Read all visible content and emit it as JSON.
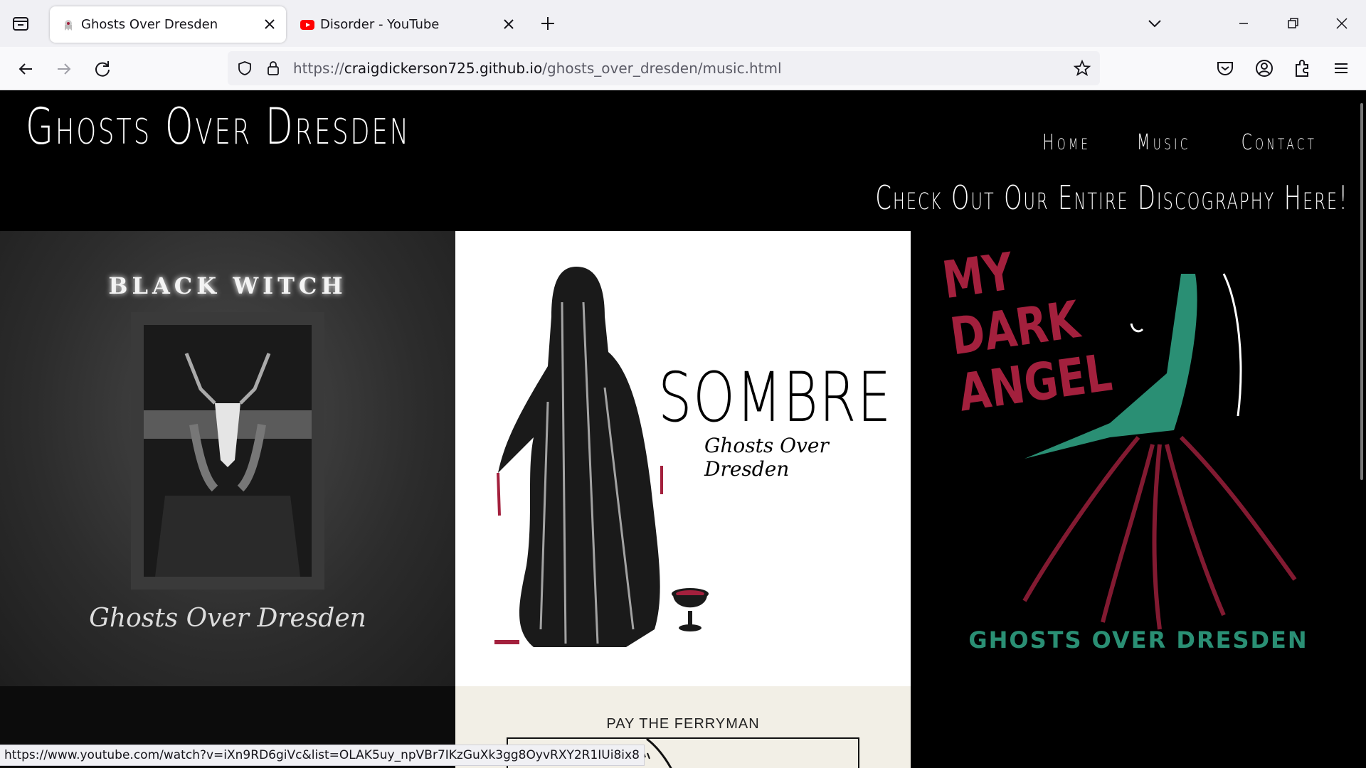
{
  "browser": {
    "tabs": [
      {
        "title": "Ghosts Over Dresden",
        "active": true,
        "favicon": "ghost-favicon"
      },
      {
        "title": "Disorder - YouTube",
        "active": false,
        "favicon": "youtube-icon"
      }
    ],
    "url": {
      "scheme": "https://",
      "host": "craigdickerson725.github.io",
      "path": "/ghosts_over_dresden/music.html"
    },
    "status_url": "https://www.youtube.com/watch?v=iXn9RD6giVc&list=OLAK5uy_npVBr7IKzGuXk3gg8OyvRXY2R1IUi8ix8"
  },
  "site": {
    "logo": "Ghosts Over Dresden",
    "nav": [
      "Home",
      "Music",
      "Contact"
    ],
    "discography_link": "Check Out Our Entire Discography Here!"
  },
  "albums": [
    {
      "title": "BLACK WITCH",
      "band": "Ghosts Over Dresden"
    },
    {
      "title": "SOMBRE",
      "band": "Ghosts Over Dresden"
    },
    {
      "title": "MY\nDARK\nANGEL",
      "band": "GHOSTS OVER DRESDEN"
    },
    {
      "title": "PAY THE FERRYMAN"
    }
  ],
  "colors": {
    "page_bg": "#000000",
    "text": "#ffffff",
    "dark_angel_red": "#a3203d",
    "dark_angel_teal": "#2a8f74"
  }
}
